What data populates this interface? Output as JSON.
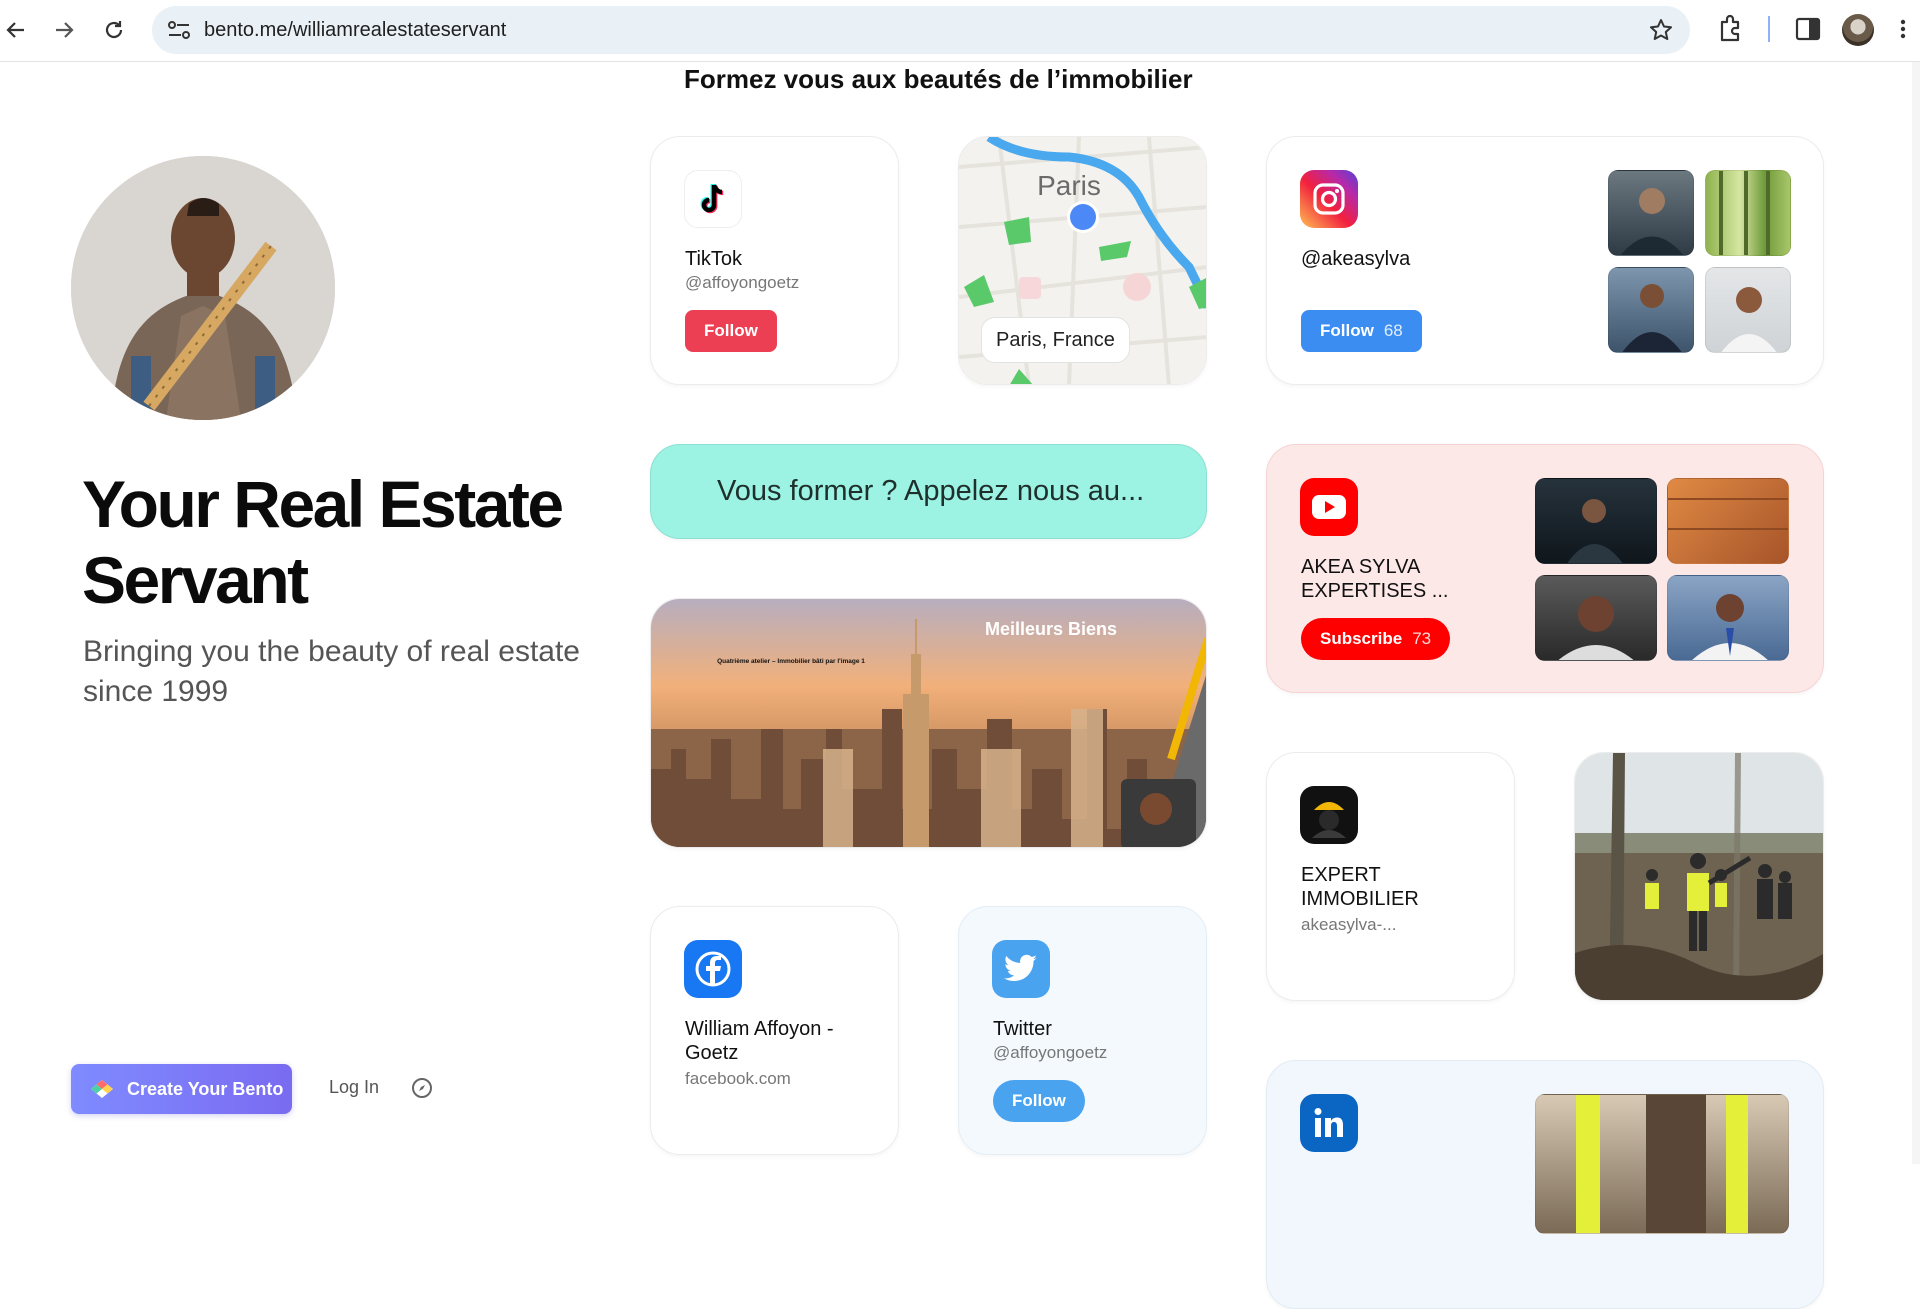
{
  "browser": {
    "url": "bento.me/williamrealestateservant",
    "back_label": "Back",
    "forward_label": "Forward",
    "reload_label": "Reload"
  },
  "page": {
    "section_title": "Formez vous aux beautés de l’immobilier",
    "profile": {
      "name": "Your Real Estate Servant",
      "bio": "Bringing you the beauty of real estate since 1999"
    },
    "footer": {
      "create_label": "Create Your Bento",
      "login_label": "Log In"
    },
    "cards": {
      "tiktok": {
        "title": "TikTok",
        "handle": "@affoyongoetz",
        "button": "Follow",
        "color": "#ec3f53"
      },
      "map": {
        "city": "Paris",
        "location": "Paris, France"
      },
      "instagram": {
        "handle": "@akeasylva",
        "button": "Follow",
        "count": "68",
        "color": "#3c8df1"
      },
      "cta": {
        "text": "Vous former ? Appelez nous au...",
        "color": "#9cf3e3"
      },
      "banner": {
        "overlay": "Meilleurs Biens",
        "caption": "Quatrième atelier – Immobilier bâti par l'image 1"
      },
      "youtube": {
        "title": "AKEA SYLVA EXPERTISES ...",
        "button": "Subscribe",
        "count": "73",
        "color": "#ff0000"
      },
      "expert": {
        "title": "EXPERT IMMOBILIER",
        "sub": "akeasylva-..."
      },
      "facebook": {
        "title": "William Affoyon - Goetz",
        "sub": "facebook.com"
      },
      "twitter": {
        "title": "Twitter",
        "handle": "@affoyongoetz",
        "button": "Follow",
        "color": "#4aa3ef"
      },
      "linkedin": {
        "icon": "linkedin-icon"
      }
    }
  }
}
